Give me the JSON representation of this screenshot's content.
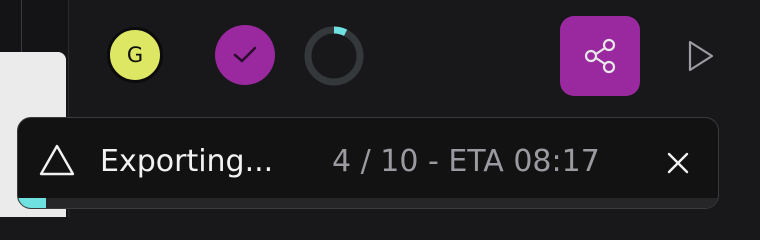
{
  "user": {
    "avatar_initial": "G"
  },
  "icons": {
    "check": "check-icon",
    "spinner": "loading-spinner-icon",
    "share": "share-icon",
    "play": "play-icon",
    "warning": "warning-triangle-icon",
    "close": "close-icon"
  },
  "toast": {
    "title": "Exporting...",
    "progress_text": "4 / 10 - ETA 08:17",
    "progress_fraction": 0.4
  },
  "colors": {
    "accent": "#9a29a0",
    "avatar": "#dde763",
    "progress": "#6fe1e1"
  }
}
